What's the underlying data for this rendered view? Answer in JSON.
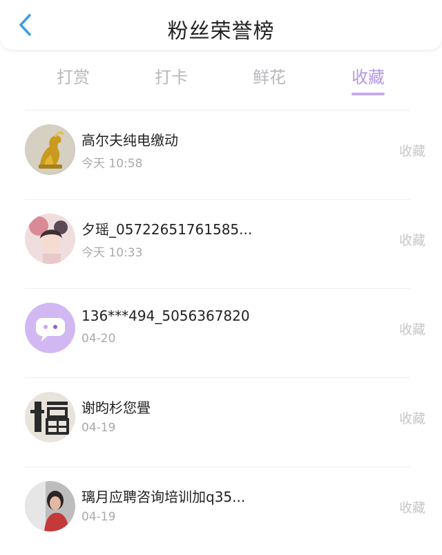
{
  "header": {
    "title": "粉丝荣誉榜",
    "back_icon": "chevron-left-icon",
    "accent_color": "#3a9de8"
  },
  "tabs": [
    {
      "label": "打赏",
      "active": false
    },
    {
      "label": "打卡",
      "active": false
    },
    {
      "label": "鲜花",
      "active": false
    },
    {
      "label": "收藏",
      "active": true
    }
  ],
  "tab_active_color": "#b597e6",
  "list": [
    {
      "name": "高尔夫纯电缴动",
      "time": "今天 10:58",
      "action": "收藏",
      "avatar": "gold-horse-avatar"
    },
    {
      "name": "夕瑶_05722651761585...",
      "time": "今天 10:33",
      "action": "收藏",
      "avatar": "portrait-avatar"
    },
    {
      "name": "136***494_5056367820",
      "time": "04-20",
      "action": "收藏",
      "avatar": "chat-bubble-avatar"
    },
    {
      "name": "谢昀杉您舋",
      "time": "04-19",
      "action": "收藏",
      "avatar": "fu-character-avatar"
    },
    {
      "name": "璃月应聘咨询培训加q35...",
      "time": "04-19",
      "action": "收藏",
      "avatar": "photo-avatar"
    }
  ]
}
